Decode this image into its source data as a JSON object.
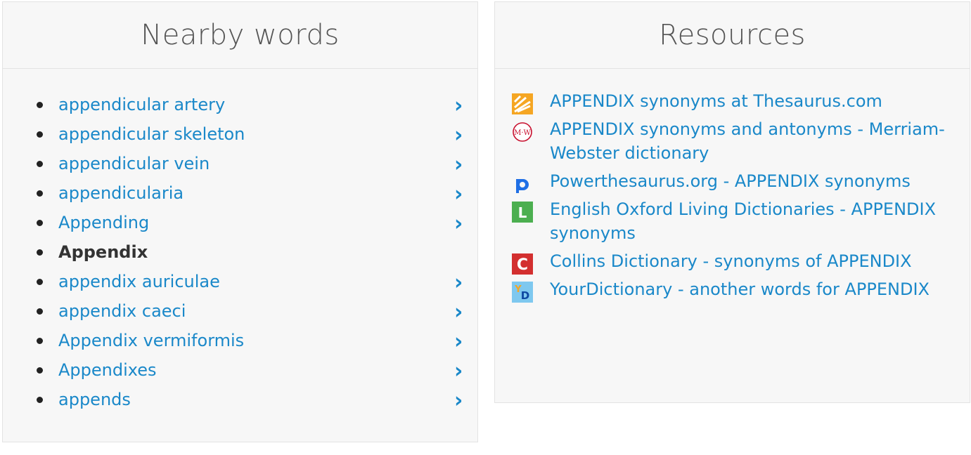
{
  "nearby": {
    "title": "Nearby words",
    "items": [
      {
        "label": "appendicular artery",
        "current": false
      },
      {
        "label": "appendicular skeleton",
        "current": false
      },
      {
        "label": "appendicular vein",
        "current": false
      },
      {
        "label": "appendicularia",
        "current": false
      },
      {
        "label": "Appending",
        "current": false
      },
      {
        "label": "Appendix",
        "current": true
      },
      {
        "label": "appendix auriculae",
        "current": false
      },
      {
        "label": "appendix caeci",
        "current": false
      },
      {
        "label": "Appendix vermiformis",
        "current": false
      },
      {
        "label": "Appendixes",
        "current": false
      },
      {
        "label": "appends",
        "current": false
      }
    ],
    "chevron": "›"
  },
  "resources": {
    "title": "Resources",
    "items": [
      {
        "label": "APPENDIX synonyms at Thesaurus.com",
        "icon": "thesaurus-icon"
      },
      {
        "label": "APPENDIX synonyms and antonyms - Merriam-Webster dictionary",
        "icon": "merriam-webster-icon"
      },
      {
        "label": "Powerthesaurus.org - APPENDIX synonyms",
        "icon": "powerthesaurus-icon"
      },
      {
        "label": "English Oxford Living Dictionaries - APPENDIX synonyms",
        "icon": "oxford-icon"
      },
      {
        "label": "Collins Dictionary - synonyms of APPENDIX",
        "icon": "collins-icon"
      },
      {
        "label": "YourDictionary - another words for APPENDIX",
        "icon": "yourdictionary-icon"
      }
    ],
    "icon_text": {
      "merriam_webster": "M·W",
      "oxford": "L",
      "collins": "C",
      "yourdictionary_y": "Y",
      "yourdictionary_d": "D"
    }
  },
  "colors": {
    "link": "#1a88c9",
    "card_bg": "#f7f7f7",
    "border": "#e3e3e3",
    "title": "#555555"
  }
}
